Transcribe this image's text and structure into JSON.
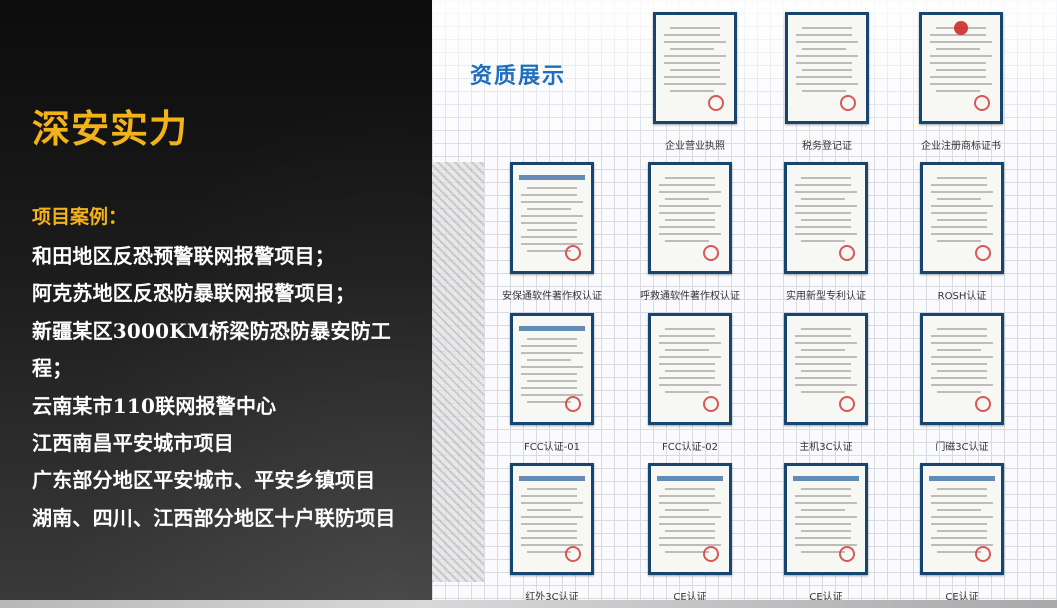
{
  "left": {
    "title": "深安实力",
    "section_label": "项目案例：",
    "cases": [
      "和田地区反恐预警联网报警项目；",
      "阿克苏地区反恐防暴联网报警项目；",
      "新疆某区3000KM桥梁防恐防暴安防工",
      "程；",
      "云南某市110联网报警中心",
      "江西南昌平安城市项目",
      "广东部分地区平安城市、平安乡镇项目",
      "湖南、四川、江西部分地区十户联防项目"
    ]
  },
  "right": {
    "heading": "资质展示",
    "certificates": [
      {
        "caption": "企业营业执照"
      },
      {
        "caption": "税务登记证"
      },
      {
        "caption": "企业注册商标证书"
      },
      {
        "caption": "安保通软件著作权认证"
      },
      {
        "caption": "呼救通软件著作权认证"
      },
      {
        "caption": "实用新型专利认证"
      },
      {
        "caption": "ROSH认证"
      },
      {
        "caption": "FCC认证-01"
      },
      {
        "caption": "FCC认证-02"
      },
      {
        "caption": "主机3C认证"
      },
      {
        "caption": "门磁3C认证"
      },
      {
        "caption": "红外3C认证"
      },
      {
        "caption": "CE认证"
      },
      {
        "caption": "CE认证"
      },
      {
        "caption": "CE认证"
      }
    ]
  },
  "colors": {
    "accent_gold": "#f4b21a",
    "heading_blue": "#1f6fbf",
    "frame_navy": "#16466f"
  }
}
